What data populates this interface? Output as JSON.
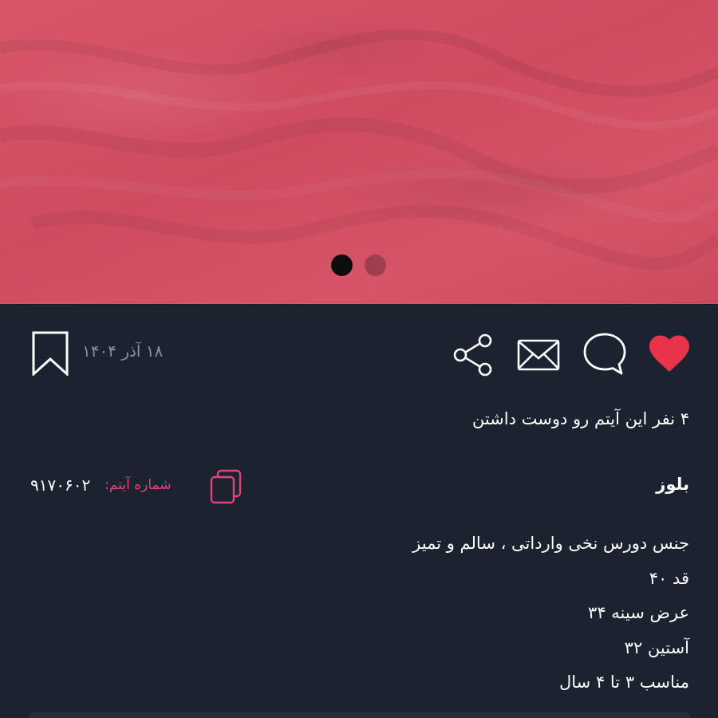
{
  "image_carousel": {
    "total_slides": 2,
    "active_slide": 1,
    "image_color": "#d4526a"
  },
  "actions": {
    "like_icon": "heart-icon",
    "comment_icon": "speech-bubble-icon",
    "message_icon": "envelope-icon",
    "share_icon": "share-icon",
    "bookmark_icon": "bookmark-icon",
    "liked_color": "#e8334a"
  },
  "post": {
    "date": "۱۸ آذر ۱۴۰۴",
    "likes_text": "۴ نفر این آیتم رو دوست داشتن",
    "title": "بلوز",
    "item_number_label": "شماره آیتم:",
    "item_number": "۹۱۷۰۶۰۲",
    "description": [
      "جنس دورس نخی وارداتی ، سالم و تمیز",
      "قد ۴۰",
      "عرض سینه ۳۴",
      "آستین ۳۲",
      "مناسب ۳ تا ۴ سال"
    ]
  },
  "theme": {
    "background": "#1b2330",
    "accent": "#e0427a",
    "muted_text": "#8a919c"
  }
}
